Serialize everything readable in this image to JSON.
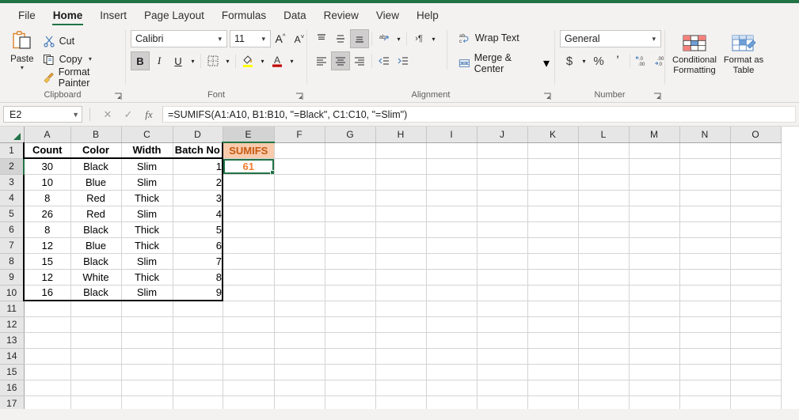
{
  "ribbon": {
    "tabs": [
      {
        "label": "File",
        "active": false
      },
      {
        "label": "Home",
        "active": true
      },
      {
        "label": "Insert",
        "active": false
      },
      {
        "label": "Page Layout",
        "active": false
      },
      {
        "label": "Formulas",
        "active": false
      },
      {
        "label": "Data",
        "active": false
      },
      {
        "label": "Review",
        "active": false
      },
      {
        "label": "View",
        "active": false
      },
      {
        "label": "Help",
        "active": false
      }
    ],
    "clipboard": {
      "group_label": "Clipboard",
      "paste_label": "Paste",
      "cut_label": "Cut",
      "copy_label": "Copy",
      "format_painter_label": "Format Painter"
    },
    "font": {
      "group_label": "Font",
      "font_name": "Calibri",
      "font_size": "11",
      "bold_label": "B",
      "italic_label": "I",
      "underline_label": "U",
      "grow_font_label": "A",
      "shrink_font_label": "A",
      "fill_color_label": "A",
      "font_color_label": "A"
    },
    "alignment": {
      "group_label": "Alignment",
      "wrap_text_label": "Wrap Text",
      "merge_center_label": "Merge & Center"
    },
    "number": {
      "group_label": "Number",
      "format": "General",
      "currency_label": "$",
      "percent_label": "%",
      "comma_label": "’"
    },
    "styles": {
      "conditional_formatting_label": "Conditional Formatting",
      "format_as_table_label": "Format as Table"
    }
  },
  "formula_bar": {
    "name_box": "E2",
    "formula": "=SUMIFS(A1:A10, B1:B10, \"=Black\", C1:C10, \"=Slim\")",
    "cancel_label": "✕",
    "enter_label": "✓",
    "fx_label": "fx"
  },
  "sheet": {
    "columns": [
      "A",
      "B",
      "C",
      "D",
      "E",
      "F",
      "G",
      "H",
      "I",
      "J",
      "K",
      "L",
      "M",
      "N",
      "O"
    ],
    "selected_column": "E",
    "selected_row": 2,
    "selected_cell": "E2",
    "rows": [
      1,
      2,
      3,
      4,
      5,
      6,
      7,
      8,
      9,
      10,
      11,
      12,
      13,
      14,
      15,
      16,
      17
    ],
    "headers": {
      "A": "Count",
      "B": "Color",
      "C": "Width",
      "D": "Batch No",
      "E": "SUMIFS"
    },
    "data": [
      {
        "row": 2,
        "A": "30",
        "B": "Black",
        "C": "Slim",
        "D": "1",
        "E": "61"
      },
      {
        "row": 3,
        "A": "10",
        "B": "Blue",
        "C": "Slim",
        "D": "2",
        "E": ""
      },
      {
        "row": 4,
        "A": "8",
        "B": "Red",
        "C": "Thick",
        "D": "3",
        "E": ""
      },
      {
        "row": 5,
        "A": "26",
        "B": "Red",
        "C": "Slim",
        "D": "4",
        "E": ""
      },
      {
        "row": 6,
        "A": "8",
        "B": "Black",
        "C": "Thick",
        "D": "5",
        "E": ""
      },
      {
        "row": 7,
        "A": "12",
        "B": "Blue",
        "C": "Thick",
        "D": "6",
        "E": ""
      },
      {
        "row": 8,
        "A": "15",
        "B": "Black",
        "C": "Slim",
        "D": "7",
        "E": ""
      },
      {
        "row": 9,
        "A": "12",
        "B": "White",
        "C": "Thick",
        "D": "8",
        "E": ""
      },
      {
        "row": 10,
        "A": "16",
        "B": "Black",
        "C": "Slim",
        "D": "9",
        "E": ""
      }
    ],
    "colors": {
      "sumifs_header_bg": "#f8cbad",
      "sumifs_header_fg": "#c55a11",
      "sumifs_value_fg": "#ed7d31",
      "selection_border": "#217346"
    }
  }
}
